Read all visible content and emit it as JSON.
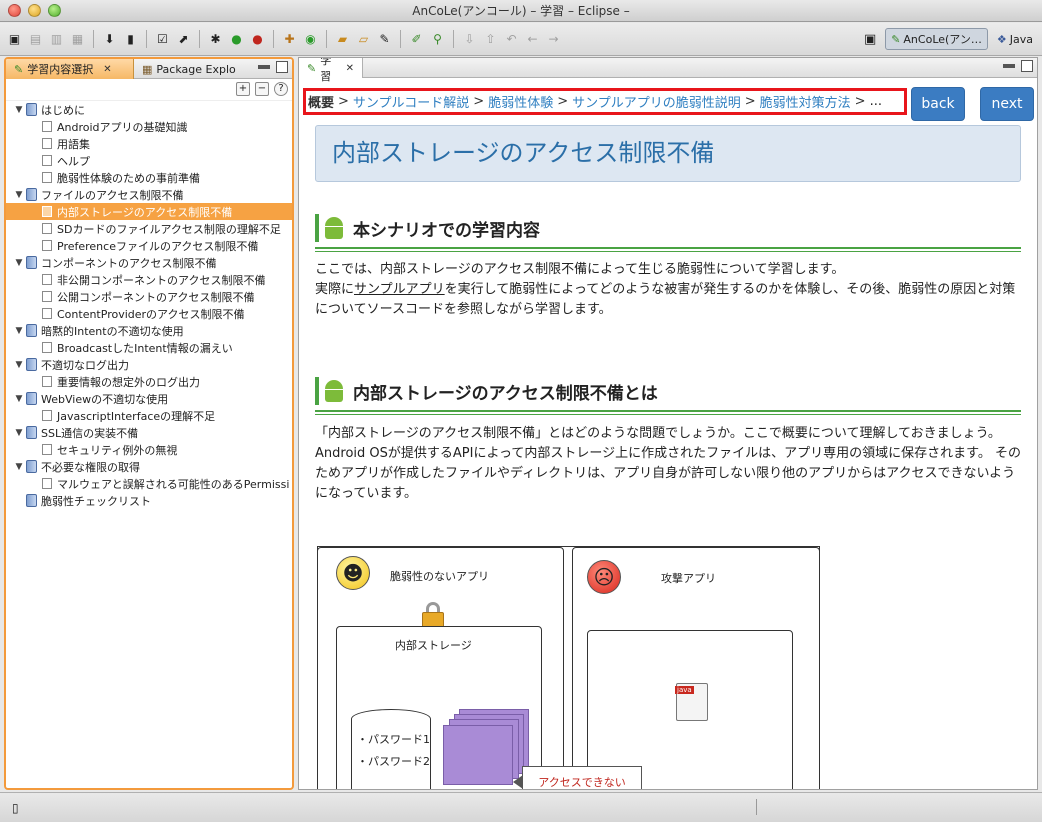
{
  "window": {
    "title": "AnCoLe(アンコール) – 学習 – Eclipse –"
  },
  "toolbar": {
    "icons": [
      "new-wizard-icon",
      "save-icon",
      "save-all-icon",
      "print-icon",
      "import-icon",
      "device-icon",
      "checkbox-icon",
      "export-icon",
      "debug-icon",
      "run-icon",
      "external-tools-icon",
      "new-package-icon",
      "new-class-icon",
      "open-folder-icon",
      "open-file-icon",
      "pin-icon",
      "edit-icon",
      "search-icon",
      "next-annotation-icon",
      "prev-annotation-icon",
      "last-edit-icon",
      "back-icon",
      "forward-icon"
    ],
    "perspectives": [
      {
        "label": "AnCoLe(アン…",
        "icon": "ancole-perspective-icon",
        "active": true
      },
      {
        "label": "Java",
        "icon": "java-perspective-icon",
        "active": false
      }
    ]
  },
  "left_panel": {
    "tabs": [
      {
        "label": "学習内容選択",
        "icon": "pencil-icon",
        "active": true
      },
      {
        "label": "Package Explo",
        "icon": "package-icon",
        "active": false
      }
    ],
    "tree": [
      {
        "label": "はじめに",
        "children": [
          "Androidアプリの基礎知識",
          "用語集",
          "ヘルプ",
          "脆弱性体験のための事前準備"
        ]
      },
      {
        "label": "ファイルのアクセス制限不備",
        "children": [
          "内部ストレージのアクセス制限不備",
          "SDカードのファイルアクセス制限の理解不足",
          "Preferenceファイルのアクセス制限不備"
        ]
      },
      {
        "label": "コンポーネントのアクセス制限不備",
        "children": [
          "非公開コンポーネントのアクセス制限不備",
          "公開コンポーネントのアクセス制限不備",
          "ContentProviderのアクセス制限不備"
        ]
      },
      {
        "label": "暗黙的Intentの不適切な使用",
        "children": [
          "BroadcastしたIntent情報の漏えい"
        ]
      },
      {
        "label": "不適切なログ出力",
        "children": [
          "重要情報の想定外のログ出力"
        ]
      },
      {
        "label": "WebViewの不適切な使用",
        "children": [
          "JavascriptInterfaceの理解不足"
        ]
      },
      {
        "label": "SSL通信の実装不備",
        "children": [
          "セキュリティ例外の無視"
        ]
      },
      {
        "label": "不必要な権限の取得",
        "children": [
          "マルウェアと誤解される可能性のあるPermissi"
        ]
      },
      {
        "label": "脆弱性チェックリスト",
        "children": []
      }
    ],
    "selected": "内部ストレージのアクセス制限不備"
  },
  "editor": {
    "tab_label": "学習",
    "breadcrumb": {
      "current": "概要",
      "links": [
        "サンプルコード解説",
        "脆弱性体験",
        "サンプルアプリの脆弱性説明",
        "脆弱性対策方法"
      ],
      "ellipsis": "..."
    },
    "back_label": "back",
    "next_label": "next",
    "page_title": "内部ストレージのアクセス制限不備",
    "section1": {
      "heading": "本シナリオでの学習内容",
      "p1": "ここでは、内部ストレージのアクセス制限不備によって生じる脆弱性について学習します。",
      "p2_pre": "実際に",
      "p2_link": "サンプルアプリ",
      "p2_post": "を実行して脆弱性によってどのような被害が発生するのかを体験し、その後、脆弱性の原因と対策についてソースコードを参照しながら学習します。"
    },
    "section2": {
      "heading": "内部ストレージのアクセス制限不備とは",
      "p1": "「内部ストレージのアクセス制限不備」とはどのような問題でしょうか。ここで概要について理解しておきましょう。",
      "p2": "Android OSが提供するAPIによって内部ストレージ上に作成されたファイルは、アプリ専用の領域に保存されます。 そのためアプリが作成したファイルやディレクトリは、アプリ自身が許可しない限り他のアプリからはアクセスできないようになっています。"
    },
    "diagram": {
      "safe_app_label": "脆弱性のないアプリ",
      "attacker_label": "攻撃アプリ",
      "storage_label": "内部ストレージ",
      "password1": "・パスワード1",
      "password2": "・パスワード2",
      "no_access": "アクセスできない",
      "java_tag": "java"
    }
  },
  "colors": {
    "accent": "#f6a243",
    "link": "#2f7fc1",
    "button": "#3b7cc2",
    "heading_green": "#4aa343",
    "highlight_red": "#e8151b"
  }
}
